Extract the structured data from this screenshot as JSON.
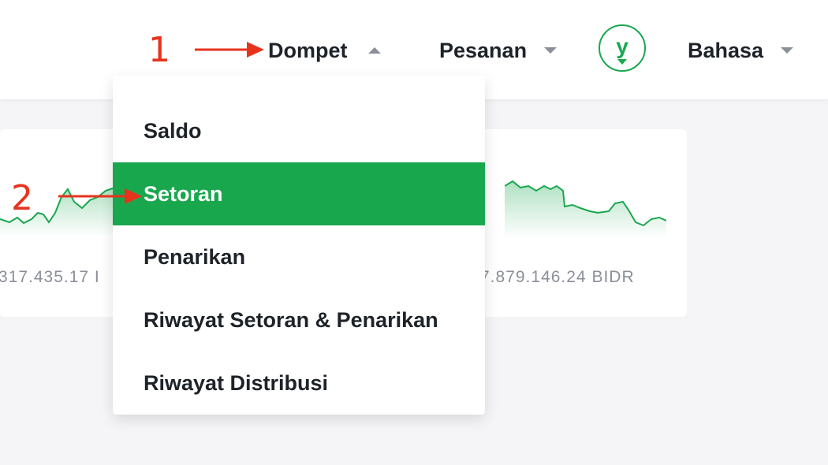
{
  "header": {
    "nav": [
      {
        "label": "Dompet",
        "expanded": true
      },
      {
        "label": "Pesanan",
        "expanded": false
      },
      {
        "label": "Bahasa",
        "expanded": false
      }
    ],
    "avatar": {
      "letter": "y",
      "icon": "user-avatar-icon"
    }
  },
  "dropdown": {
    "items": [
      {
        "label": "Saldo",
        "active": false
      },
      {
        "label": "Setoran",
        "active": true
      },
      {
        "label": "Penarikan",
        "active": false
      },
      {
        "label": "Riwayat Setoran & Penarikan",
        "active": false
      },
      {
        "label": "Riwayat Distribusi",
        "active": false
      }
    ]
  },
  "cards": [
    {
      "value": "317.435.17 I"
    },
    {
      "value": "7.879.146.24 BIDR"
    }
  ],
  "annotations": [
    {
      "label": "1"
    },
    {
      "label": "2"
    }
  ],
  "colors": {
    "accent": "#19a74e",
    "annotation": "#e8331c",
    "muted_text": "#8a8f98",
    "text": "#1e2329"
  }
}
